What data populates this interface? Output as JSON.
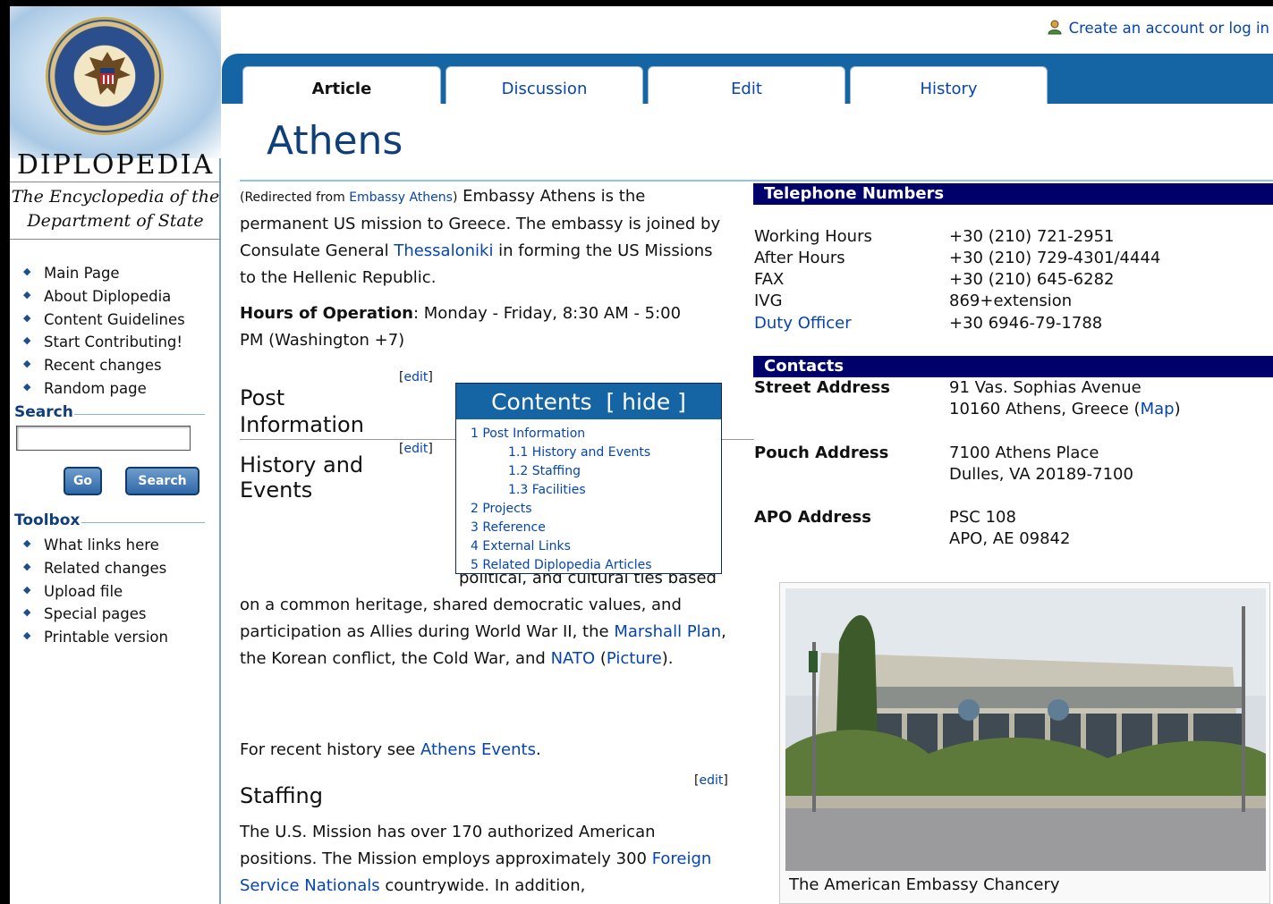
{
  "sidebar": {
    "brand": "DIPLOPEDIA",
    "tagline": "The Encyclopedia of the Department of State",
    "nav": [
      "Main Page",
      "About Diplopedia",
      "Content Guidelines",
      "Start Contributing!",
      "Recent changes",
      "Random page"
    ],
    "search": {
      "title": "Search",
      "value": "",
      "go_label": "Go",
      "search_label": "Search"
    },
    "toolbox": {
      "title": "Toolbox",
      "items": [
        "What links here",
        "Related changes",
        "Upload file",
        "Special pages",
        "Printable version"
      ]
    }
  },
  "header": {
    "account_link": "Create an account or log in",
    "tabs": [
      {
        "label": "Article",
        "active": true
      },
      {
        "label": "Discussion",
        "active": false
      },
      {
        "label": "Edit",
        "active": false
      },
      {
        "label": "History",
        "active": false
      }
    ]
  },
  "article": {
    "title": "Athens",
    "redirect_prefix": "(Redirected from ",
    "redirect_link": "Embassy Athens",
    "redirect_suffix": ")",
    "intro_1": " Embassy Athens is the permanent US mission to Greece. The embassy is joined by Consulate General ",
    "intro_link": "Thessaloniki",
    "intro_2": " in forming the US Missions to the Hellenic Republic.",
    "hours_label": "Hours of Operation",
    "hours_text": ": Monday - Friday, 8:30 AM - 5:00 PM (Washington +7)",
    "edit_label": "edit",
    "sections": {
      "post_information": "Post Information",
      "history": "History and Events",
      "staffing": "Staffing"
    },
    "history_p1": "The United States and Greece have longstanding historical, political, and cultural ties based on a common heritage, shared democratic values, and participation as Allies during World War II, the ",
    "history_link1": "Marshall Plan",
    "history_p2": ", the Korean conflict, the Cold War, and ",
    "history_link2": "NATO",
    "history_p3": " (",
    "history_link3": "Picture",
    "history_p4": ").",
    "recent_prefix": "For recent history see ",
    "recent_link": "Athens Events",
    "recent_suffix": ".",
    "staffing_p1": "The U.S. Mission has over 170 authorized American positions. The Mission employs approximately 300 ",
    "staffing_link": "Foreign Service Nationals",
    "staffing_p2": " countrywide. In addition,"
  },
  "toc": {
    "title": "Contents",
    "hide_label": "[ hide ]",
    "items": [
      {
        "label": "1 Post Information",
        "sub": false
      },
      {
        "label": "1.1 History and Events",
        "sub": true
      },
      {
        "label": "1.2 Staffing",
        "sub": true
      },
      {
        "label": "1.3 Facilities",
        "sub": true
      },
      {
        "label": "2 Projects",
        "sub": false
      },
      {
        "label": "3 Reference",
        "sub": false
      },
      {
        "label": "4 External Links",
        "sub": false
      },
      {
        "label": "5 Related Diplopedia Articles",
        "sub": false
      }
    ]
  },
  "telephone": {
    "title": "Telephone Numbers",
    "rows": [
      {
        "label": "Working Hours",
        "value": "+30 (210) 721-2951",
        "link": false
      },
      {
        "label": "After Hours",
        "value": "+30 (210) 729-4301/4444",
        "link": false
      },
      {
        "label": "FAX",
        "value": "+30 (210) 645-6282",
        "link": false
      },
      {
        "label": "IVG",
        "value": "869+extension",
        "link": false
      },
      {
        "label": "Duty Officer",
        "value": "+30 6946-79-1788",
        "link": true
      }
    ]
  },
  "contacts": {
    "title": "Contacts",
    "street_label": "Street Address",
    "street_line1": "91 Vas. Sophias Avenue",
    "street_line2_pre": "10160 Athens, Greece (",
    "street_map_link": "Map",
    "street_line2_post": ")",
    "pouch_label": "Pouch Address",
    "pouch_line1": "7100 Athens Place",
    "pouch_line2": "Dulles, VA 20189-7100",
    "apo_label": "APO Address",
    "apo_line1": "PSC 108",
    "apo_line2": "APO, AE 09842"
  },
  "photo": {
    "caption": "The American Embassy Chancery"
  },
  "colors": {
    "tab_strip": "#1565a5",
    "heading_bar": "#00006b",
    "link": "#0645ad",
    "title": "#0f3e78"
  }
}
